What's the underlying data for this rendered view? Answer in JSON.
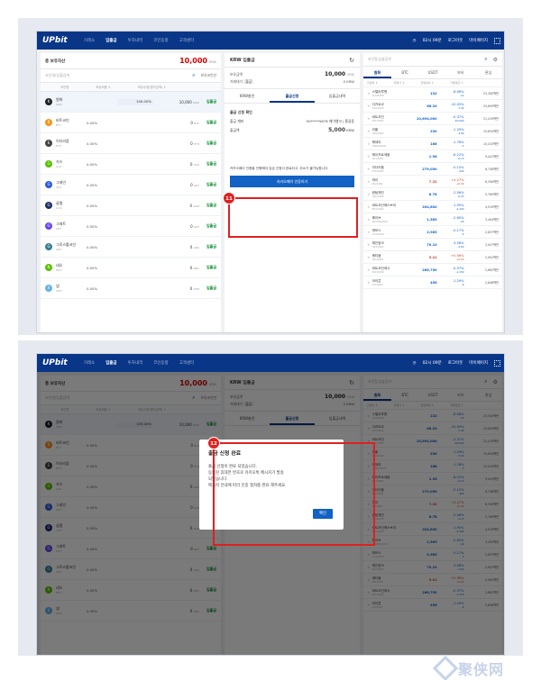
{
  "nav": {
    "logo": "UPbit",
    "items": [
      "거래소",
      "입출금",
      "투자내역",
      "코인동향",
      "고객센터"
    ],
    "active_index": 1,
    "time": "02시 09분",
    "logout": "로그아웃",
    "mypage": "마이페이지"
  },
  "assets": {
    "title": "총 보유자산",
    "total": "10,000",
    "unit": "KRW",
    "search_placeholder": "코인명/심볼검색",
    "search_option": "보유코인만",
    "columns": [
      "코인명",
      "보유비중 ↕",
      "보유수량(평가금액) ↕"
    ],
    "coins": [
      {
        "name": "원화",
        "symbol": "KRW",
        "pct": "100.00%",
        "amt": "10,000",
        "unit": "KRW",
        "btn": "입출금",
        "color": "#222"
      },
      {
        "name": "비트코인",
        "symbol": "BTC",
        "pct": "0.00%",
        "amt": "0",
        "unit": "BTC",
        "btn": "입출금",
        "color": "#f7931a"
      },
      {
        "name": "이더리움",
        "symbol": "ETH",
        "pct": "0.00%",
        "amt": "0",
        "unit": "ETH",
        "btn": "입출금",
        "color": "#444"
      },
      {
        "name": "가스",
        "symbol": "GAS",
        "pct": "0.00%",
        "amt": "0",
        "unit": "GAS",
        "btn": "입출금",
        "color": "#58bf00"
      },
      {
        "name": "그레인",
        "symbol": "GRT",
        "pct": "0.00%",
        "amt": "0",
        "unit": "GRT",
        "btn": "입출금",
        "color": "#2a5ada"
      },
      {
        "name": "골렘",
        "symbol": "GLM",
        "pct": "0.00%",
        "amt": "0",
        "unit": "GLM",
        "btn": "입출금",
        "color": "#1d2e6a"
      },
      {
        "name": "그레트",
        "symbol": "GRT",
        "pct": "0.00%",
        "amt": "0",
        "unit": "GRT",
        "btn": "입출금",
        "color": "#6747ed"
      },
      {
        "name": "그로스톨코인",
        "symbol": "GRS",
        "pct": "0.00%",
        "amt": "0",
        "unit": "GRS",
        "btn": "입출금",
        "color": "#377e96"
      },
      {
        "name": "네오",
        "symbol": "NEO",
        "pct": "0.00%",
        "amt": "0",
        "unit": "NEO",
        "btn": "입출금",
        "color": "#58bf00"
      },
      {
        "name": "넴",
        "symbol": "XEM",
        "pct": "0.00%",
        "amt": "0",
        "unit": "XEM",
        "btn": "입출금",
        "color": "#67b2e8"
      }
    ]
  },
  "krw": {
    "title": "KRW 입출금",
    "bal_label": "보유금액",
    "bal_value": "10,000",
    "bal_unit": "KRW",
    "pending_label": "거래대기",
    "pending_tag": "출금",
    "pending_value": "0",
    "pending_unit": "KRW",
    "tabs": [
      "KRW충전",
      "출금신청",
      "입출금내역"
    ],
    "active_tab": 1,
    "section_title": "출금 신청 확인",
    "account_label": "출금 계좌",
    "account_value": "50*****5678 케이뱅크 | 홍길동",
    "amount_label": "출금액",
    "amount_value": "5,000",
    "amount_unit": "KRW",
    "notice": "카카오페이 인증을 진행해야 입금 신청이 완료되고, 취소가 불가능합니다.",
    "kakao_button": "카카오페이 인증하기"
  },
  "market": {
    "search_placeholder": "코인명/심볼검색",
    "tabs": [
      "원화",
      "BTC",
      "USDT",
      "보유",
      "관심"
    ],
    "columns": [
      "한글명 ↕",
      "현재가 ↕",
      "전일대비 ↕",
      "거래대금 ↕"
    ],
    "rows": [
      {
        "name": "스텔라루멘",
        "pair": "XLM/KRW",
        "price": "132",
        "pct": "-8.06%",
        "chg": "-12",
        "vol": "23,300백만",
        "dir": "down"
      },
      {
        "name": "디카르코",
        "pair": "DKA/KRW",
        "price": "66.20",
        "pct": "-10.05%",
        "chg": "-7.40",
        "vol": "23,609백만",
        "dir": "down"
      },
      {
        "name": "비트코인",
        "pair": "BTC/KRW",
        "price": "10,894,000",
        "pct": "-0.37%",
        "chg": "-40,000",
        "vol": "21,419백만",
        "dir": "down"
      },
      {
        "name": "리플",
        "pair": "XRP/KRW",
        "price": "230",
        "pct": "-1.29%",
        "chg": "-3.00",
        "vol": "15,654백만",
        "dir": "down"
      },
      {
        "name": "헤데라",
        "pair": "HBAR/KRW",
        "price": "168",
        "pct": "-1.76%",
        "chg": "-3",
        "vol": "10,415백만",
        "dir": "down"
      },
      {
        "name": "에이프로세움",
        "pair": "APT/KRW",
        "price": "1.96",
        "pct": "-6.22%",
        "chg": "-0.13",
        "vol": "9,441백만",
        "dir": "down"
      },
      {
        "name": "이더리움",
        "pair": "ETH/KRW",
        "price": "279,050",
        "pct": "-0.15%",
        "chg": "-420",
        "vol": "8,748백만",
        "dir": "down"
      },
      {
        "name": "파이",
        "pair": "PIA/KRW",
        "price": "7.32",
        "pct": "+4.27%",
        "chg": "+0.30",
        "vol": "8,356백만",
        "dir": "up"
      },
      {
        "name": "퀀텀체인",
        "pair": "QKC/KRW",
        "price": "8.78",
        "pct": "-2.56%",
        "chg": "-0.23",
        "vol": "5,769백만",
        "dir": "down"
      },
      {
        "name": "비트코인에스브이",
        "pair": "BSV/KRW",
        "price": "204,800",
        "pct": "-1.95%",
        "chg": "-4,100",
        "vol": "4,919백만",
        "dir": "down"
      },
      {
        "name": "웨이브",
        "pair": "WAVES/KRW",
        "price": "1,585",
        "pct": "-2.65%",
        "chg": "-40",
        "vol": "3,494백만",
        "dir": "down"
      },
      {
        "name": "퍼보스",
        "pair": "COS/KRW",
        "price": "2,985",
        "pct": "-0.17%",
        "chg": "-5",
        "vol": "2,837백만",
        "dir": "down"
      },
      {
        "name": "체인링크",
        "pair": "TRX/KRW",
        "price": "70.10",
        "pct": "-3.58%",
        "chg": "-2.60",
        "vol": "2,947백만",
        "dir": "down"
      },
      {
        "name": "쎄티움",
        "pair": "SEL/KRW",
        "price": "5.41",
        "pct": "+0.56%",
        "chg": "+0.03",
        "vol": "2,902백만",
        "dir": "up"
      },
      {
        "name": "비트코인캐시",
        "pair": "BCH/KRW",
        "price": "266,750",
        "pct": "-0.37%",
        "chg": "-1,150",
        "vol": "2,862백만",
        "dir": "down"
      },
      {
        "name": "어이콘",
        "pair": "ICX/KRW",
        "price": "456",
        "pct": "-1.29%",
        "chg": "-6",
        "vol": "2,848백만",
        "dir": "down"
      }
    ]
  },
  "step1": {
    "badge": "11"
  },
  "step2": {
    "badge": "12",
    "modal_title": "출금 신청 완료",
    "modal_lines": [
      "출금 신청이 완료 되었습니다.",
      "등록된 휴대폰 번호로 카카오톡 메시지가 발송",
      "되었습니다.",
      "메시지 안내에 따라 인증 절차를 완료 해주세요."
    ],
    "modal_button": "확인"
  },
  "watermark": {
    "text": "聚侠网"
  },
  "colors": {
    "brand": "#093687",
    "accent": "#1261c4",
    "highlight": "#e02020",
    "up": "#c84a31",
    "down": "#1261c4"
  }
}
